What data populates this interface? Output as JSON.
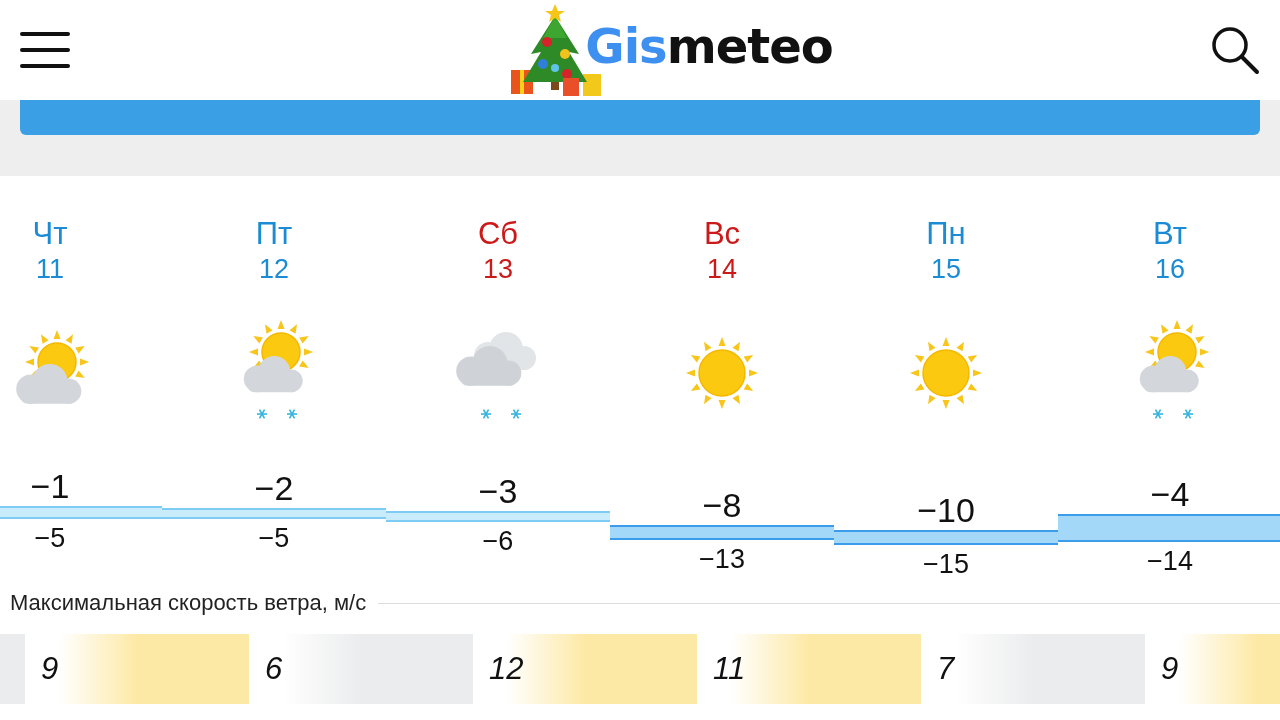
{
  "header": {
    "logo": {
      "accent": "Gis",
      "rest": "meteo"
    }
  },
  "days": [
    {
      "weekday": "Чт",
      "date": "11",
      "weekend": false,
      "kind": "partly-cloudy",
      "max": "−1",
      "min": "−5"
    },
    {
      "weekday": "Пт",
      "date": "12",
      "weekend": false,
      "kind": "partly-cloudy-snow",
      "max": "−2",
      "min": "−5"
    },
    {
      "weekday": "Сб",
      "date": "13",
      "weekend": true,
      "kind": "cloudy-snow",
      "max": "−3",
      "min": "−6"
    },
    {
      "weekday": "Вс",
      "date": "14",
      "weekend": true,
      "kind": "sunny",
      "max": "−8",
      "min": "−13"
    },
    {
      "weekday": "Пн",
      "date": "15",
      "weekend": false,
      "kind": "sunny",
      "max": "−10",
      "min": "−15"
    },
    {
      "weekday": "Вт",
      "date": "16",
      "weekend": false,
      "kind": "partly-cloudy-snow",
      "max": "−4",
      "min": "−14"
    }
  ],
  "wind": {
    "title": "Максимальная скорость ветра, м/с",
    "values": [
      {
        "kind": "partial",
        "color": "#ebeced"
      },
      {
        "kind": "full",
        "speed": "9",
        "color": "#fde9a6"
      },
      {
        "kind": "full",
        "speed": "6",
        "color": "#ebeced"
      },
      {
        "kind": "full",
        "speed": "12",
        "color": "#fde9a6"
      },
      {
        "kind": "full",
        "speed": "11",
        "color": "#fde9a6"
      },
      {
        "kind": "full",
        "speed": "7",
        "color": "#ebeced"
      },
      {
        "kind": "full",
        "speed": "9",
        "color": "#fde9a6"
      }
    ]
  }
}
